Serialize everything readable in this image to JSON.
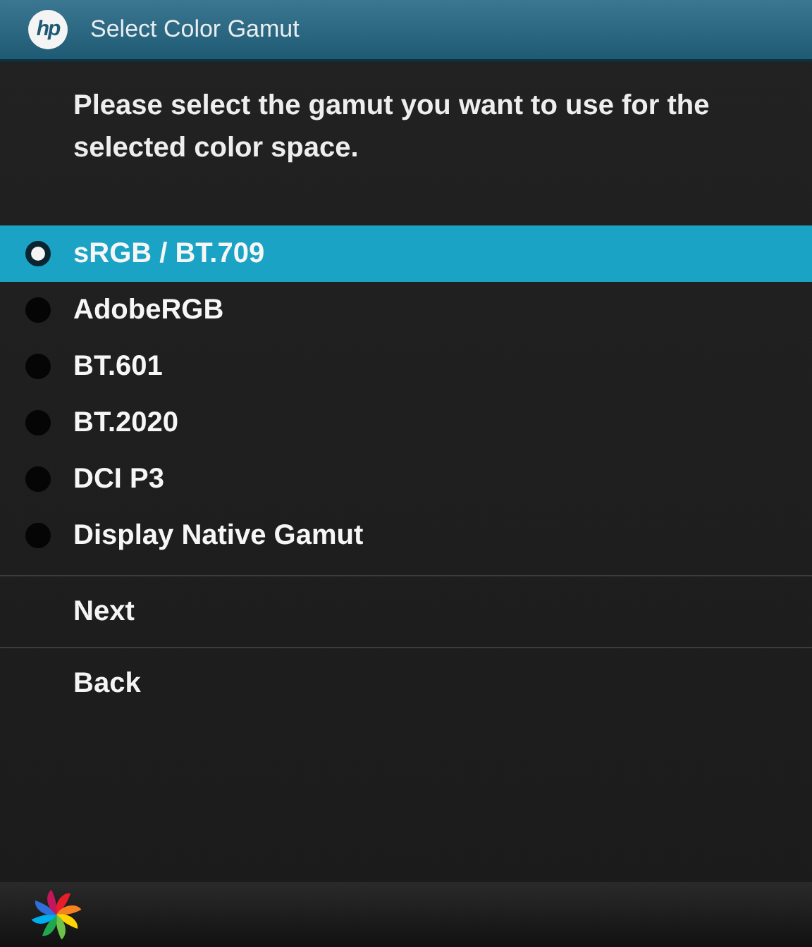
{
  "header": {
    "logo_text": "hp",
    "title": "Select Color Gamut"
  },
  "prompt": "Please select the gamut you want to use for the selected color space.",
  "options": [
    {
      "label": "sRGB / BT.709",
      "selected": true
    },
    {
      "label": "AdobeRGB",
      "selected": false
    },
    {
      "label": "BT.601",
      "selected": false
    },
    {
      "label": "BT.2020",
      "selected": false
    },
    {
      "label": "DCI P3",
      "selected": false
    },
    {
      "label": "Display Native Gamut",
      "selected": false
    }
  ],
  "actions": [
    "Next",
    "Back"
  ]
}
